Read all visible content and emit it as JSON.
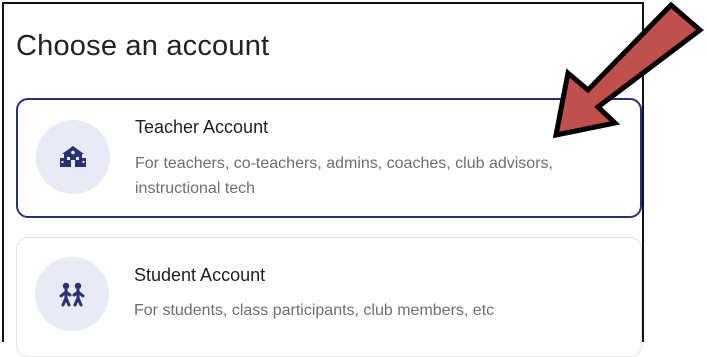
{
  "dialog": {
    "title": "Choose an account"
  },
  "accounts": [
    {
      "title": "Teacher Account",
      "description": "For teachers, co-teachers, admins, coaches, club advisors, instructional tech",
      "icon": "school-icon"
    },
    {
      "title": "Student Account",
      "description": "For students, class participants, club members, etc",
      "icon": "students-icon"
    }
  ],
  "colors": {
    "accent": "#2b3170",
    "icon_bg": "#e8eaf4",
    "arrow_fill": "#c0504d",
    "arrow_stroke": "#000000"
  }
}
